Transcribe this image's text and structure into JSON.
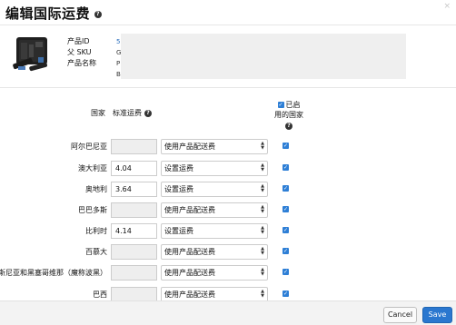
{
  "dialog": {
    "title": "编辑国际运费",
    "close_glyph": "×"
  },
  "product": {
    "labels": [
      "产品ID",
      "父 SKU",
      "产品名称"
    ],
    "values": [
      "5",
      "G",
      "P",
      "B"
    ],
    "thumbnail": "flashlight-kit-image"
  },
  "table": {
    "country_header": "国家",
    "standard_fee_header": "标准运费",
    "enabled_header_line1": "已启",
    "enabled_header_line2": "用的国家",
    "rows": [
      {
        "country": "阿尔巴尼亚",
        "fee": "",
        "option": "使用产品配送费",
        "enabled": true
      },
      {
        "country": "澳大利亚",
        "fee": "4.04",
        "option": "设置运费",
        "enabled": true
      },
      {
        "country": "奥地利",
        "fee": "3.64",
        "option": "设置运费",
        "enabled": true
      },
      {
        "country": "巴巴多斯",
        "fee": "",
        "option": "使用产品配送费",
        "enabled": true
      },
      {
        "country": "比利时",
        "fee": "4.14",
        "option": "设置运费",
        "enabled": true
      },
      {
        "country": "百慕大",
        "fee": "",
        "option": "使用产品配送费",
        "enabled": true
      },
      {
        "country": "波斯尼亚和黑塞哥维那（魔称波黑）",
        "fee": "",
        "option": "使用产品配送费",
        "enabled": true
      },
      {
        "country": "巴西",
        "fee": "",
        "option": "使用产品配送费",
        "enabled": true
      }
    ]
  },
  "footer": {
    "cancel_label": "Cancel",
    "save_label": "Save"
  },
  "colors": {
    "primary": "#2a77cf",
    "checkbox": "#2e7fd6",
    "link": "#2a6ebd"
  }
}
